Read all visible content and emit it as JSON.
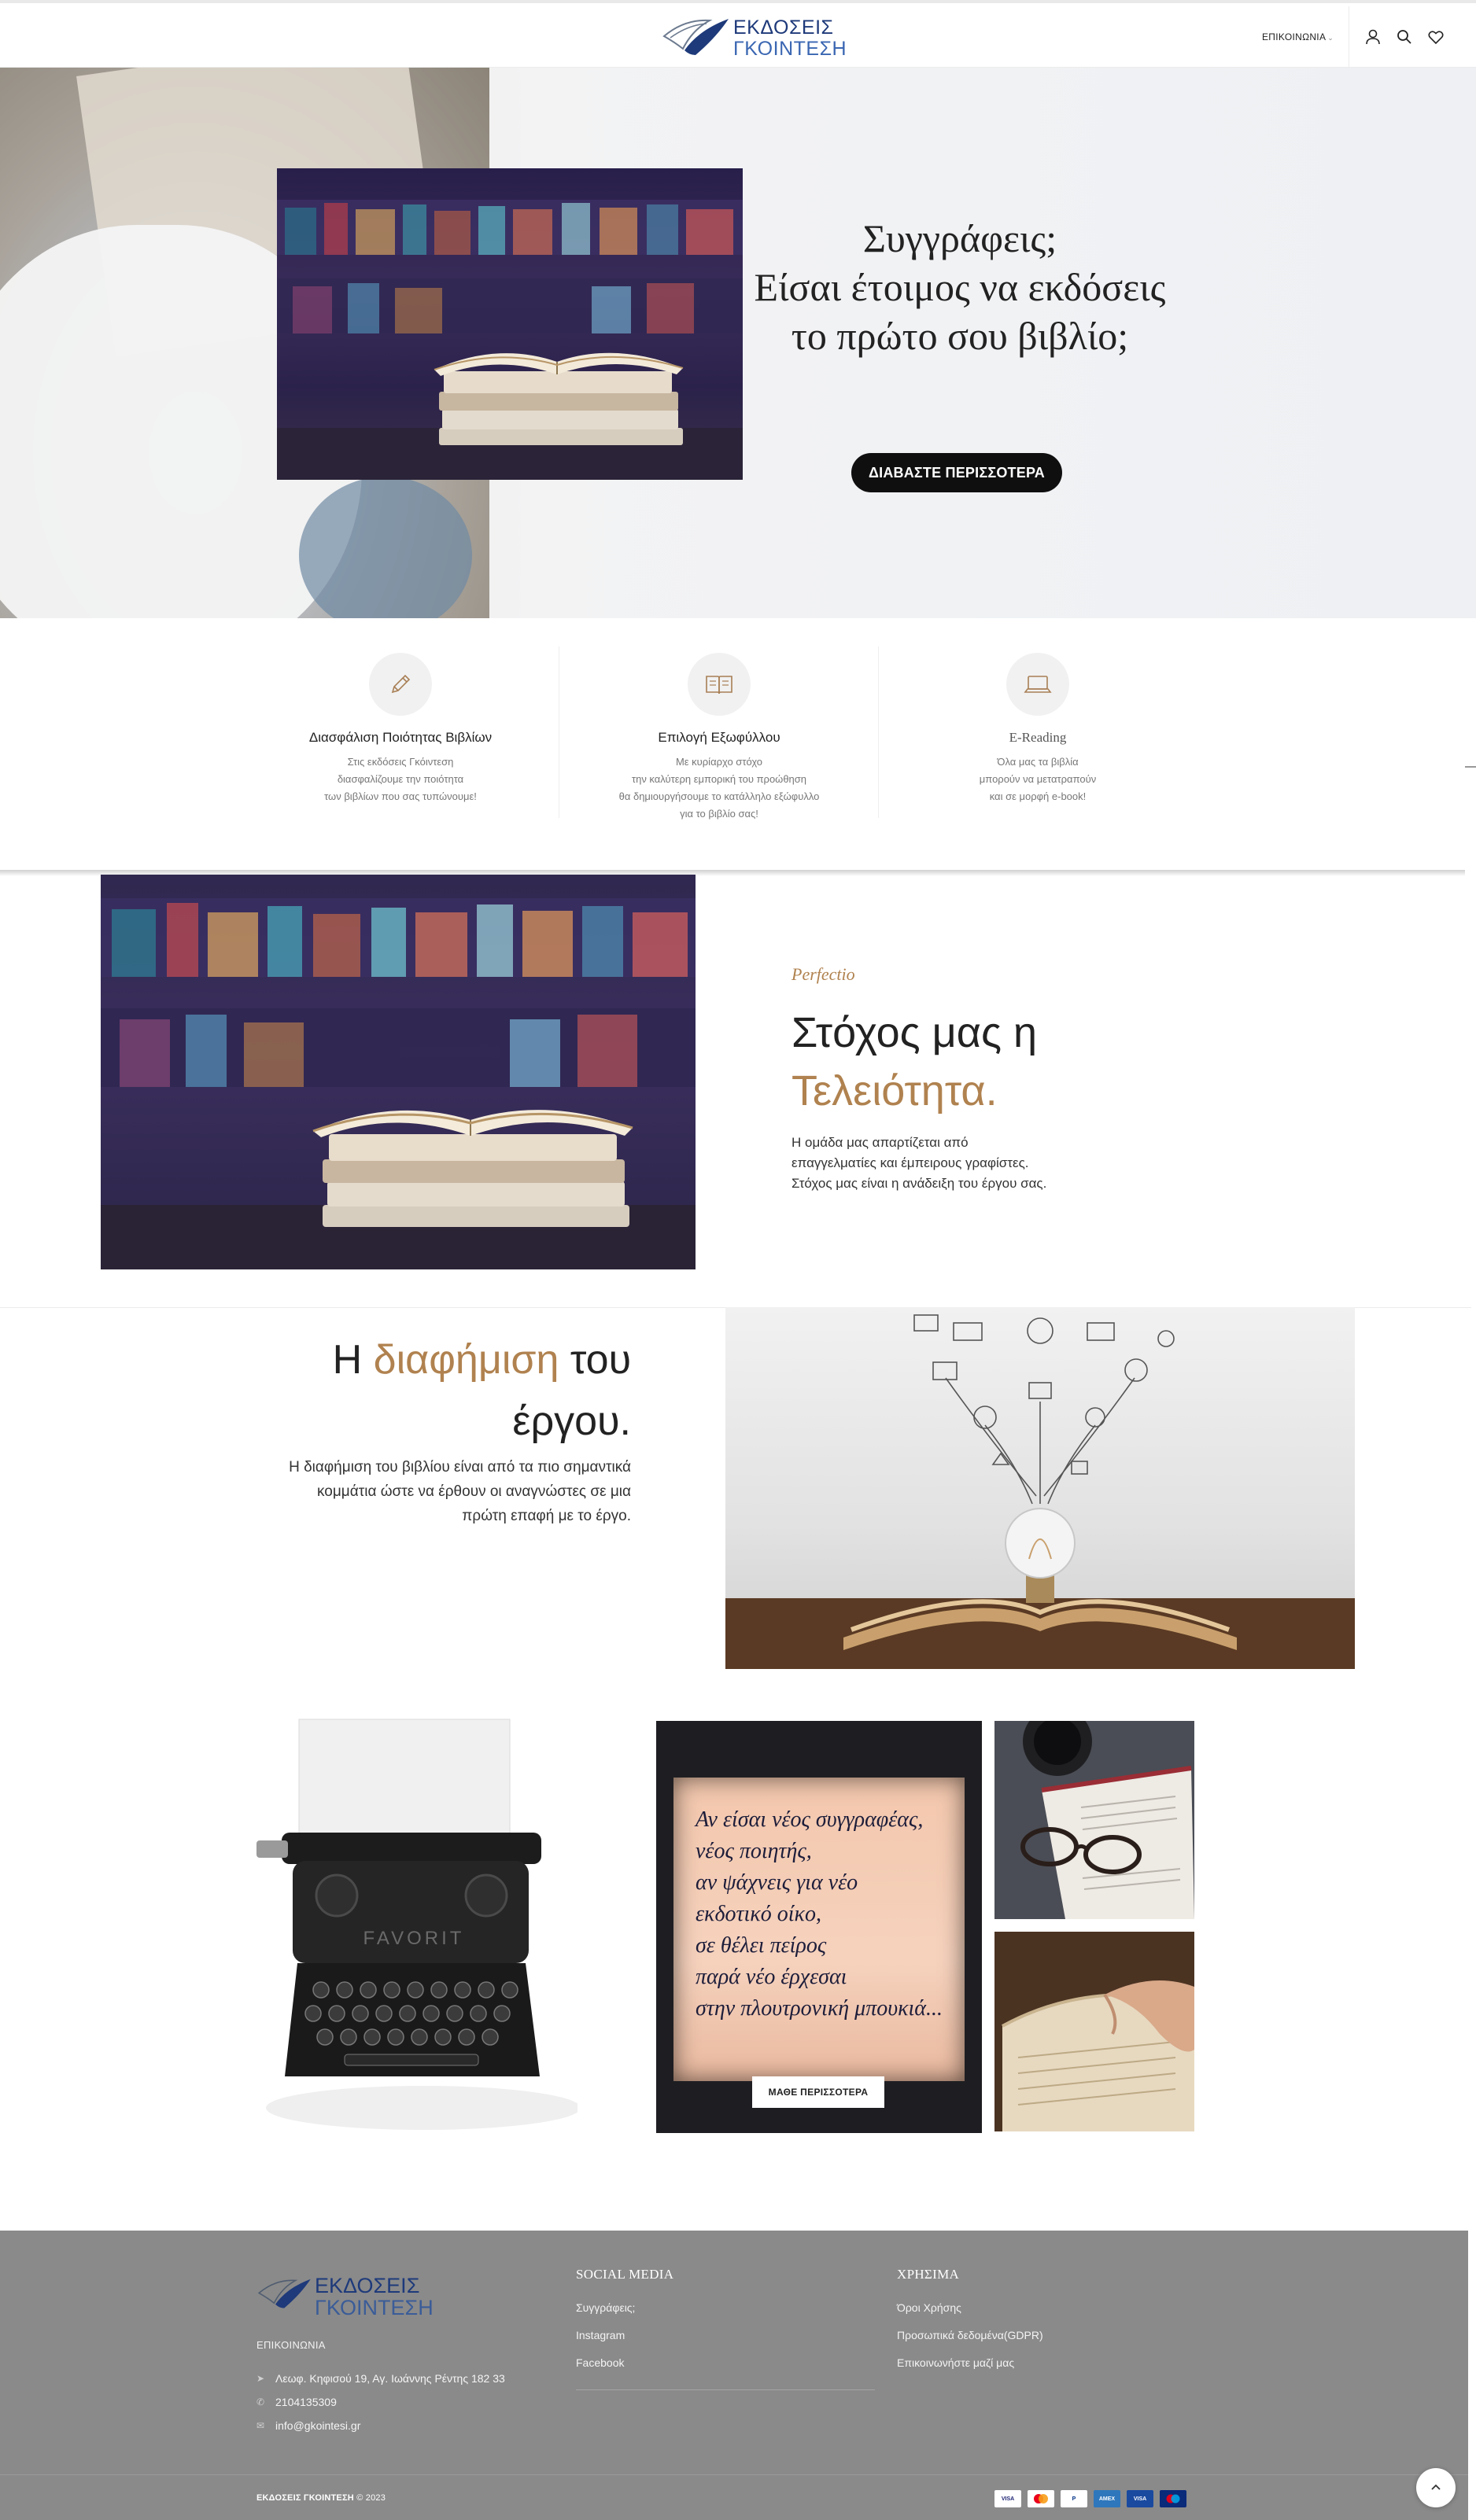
{
  "header": {
    "logo_line1": "ΕΚΔΟΣΕΙΣ",
    "logo_line2": "ΓΚΟΙΝΤΕΣΗ",
    "contact_link": "ΕΠΙΚΟΙΝΩΝΙΑ",
    "icons": [
      "user-icon",
      "search-icon",
      "heart-icon"
    ]
  },
  "hero": {
    "title_line1": "Συγγράφεις;",
    "title_line2": "Είσαι έτοιμος να εκδόσεις",
    "title_line3": "το πρώτο σου βιβλίο;",
    "button_label": "ΔΙΑΒΑΣΤΕ ΠΕΡΙΣΣΟΤΕΡΑ"
  },
  "features": [
    {
      "icon": "pencil-icon",
      "title": "Διασφάλιση Ποιότητας Βιβλίων",
      "desc": "Στις εκδόσεις Γκόιντεση\nδιασφαλίζουμε την ποιότητα\nτων βιβλίων που σας τυπώνουμε!"
    },
    {
      "icon": "open-book-icon",
      "title": "Επιλογή Εξωφύλλου",
      "desc": "Με κυρίαρχο στόχο\nτην καλύτερη εμπορική του προώθηση\nθα δημιουργήσουμε το κατάλληλο εξώφυλλο\nγια το βιβλίο σας!"
    },
    {
      "icon": "laptop-icon",
      "title": "E-Reading",
      "desc": "Όλα μας τα βιβλία\nμπορούν να μετατραπούν\nκαι σε μορφή e-book!"
    }
  ],
  "perfection": {
    "script": "Perfectio",
    "title_line1": "Στόχος μας η",
    "title_line2": "Τελειότητα.",
    "paragraph": "Η ομάδα μας απαρτίζεται από\nεπαγγελματίες και έμπειρους γραφίστες.\nΣτόχος μας είναι η ανάδειξη του έργου σας."
  },
  "advertising": {
    "title_prefix": "Η ",
    "title_accent": "διαφήμιση",
    "title_suffix": " του",
    "title_line2": "έργου.",
    "paragraph": "Η διαφήμιση του βιβλίου είναι από τα πιο σημαντικά\nκομμάτια ώστε να έρθουν οι αναγνώστες σε μια\nπρώτη επαφή με το έργο."
  },
  "gallery": {
    "note_text": "Αν είσαι νέος συγγραφέας,\nνέος ποιητής,\nαν ψάχνεις για νέο\nεκδοτικό οίκο,\nσε θέλει πείρος\nπαρά νέο έρχεσαι\nστην πλουτρονική μπουκιά...",
    "button_label": "ΜΑΘΕ ΠΕΡΙΣΣΟΤΕΡΑ"
  },
  "footer": {
    "logo_line1": "ΕΚΔΟΣΕΙΣ",
    "logo_line2": "ΓΚΟΙΝΤΕΣΗ",
    "contact_heading": "ΕΠΙΚΟΙΝΩΝΙΑ",
    "address": "Λεωφ. Κηφισού 19, Αγ. Ιωάννης Ρέντης 182 33",
    "phone": "2104135309",
    "email": "info@gkointesi.gr",
    "social_title": "SOCIAL MEDIA",
    "social_links": [
      "Συγγράφεις;",
      "Instagram",
      "Facebook"
    ],
    "useful_title": "ΧΡΗΣΙΜΑ",
    "useful_links": [
      "Όροι Χρήσης",
      "Προσωπικά δεδομένα(GDPR)",
      "Επικοινωνήστε μαζί μας"
    ],
    "copyright_brand": "ΕΚΔΟΣΕΙΣ ΓΚΟΙΝΤΕΣΗ",
    "copyright_year": "© 2023",
    "payment_icons": [
      "visa-icon",
      "mastercard-icon",
      "paypal-icon",
      "amex-icon",
      "visa-electron-icon",
      "maestro-icon"
    ],
    "payment_labels": [
      "VISA",
      "",
      "P",
      "AMEX",
      "VISA",
      "maestro"
    ],
    "colors": {
      "background": "#8a8a8a",
      "accent": "#b0824f",
      "brand": "#1e3a7a"
    }
  }
}
